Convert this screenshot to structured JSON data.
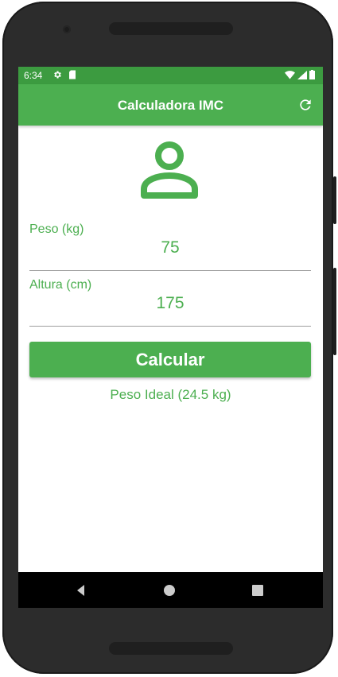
{
  "status_bar": {
    "time": "6:34",
    "left_icons": [
      "gear-icon",
      "sd-card-icon"
    ],
    "right_icons": [
      "wifi-icon",
      "signal-icon",
      "battery-icon"
    ]
  },
  "app_bar": {
    "title": "Calculadora IMC",
    "action_icon": "refresh-icon"
  },
  "main": {
    "avatar_icon": "person-icon",
    "weight_field": {
      "label": "Peso (kg)",
      "value": "75"
    },
    "height_field": {
      "label": "Altura (cm)",
      "value": "175"
    },
    "calculate_button": "Calcular",
    "result": "Peso Ideal (24.5 kg)"
  },
  "nav_bar": {
    "buttons": [
      "back-icon",
      "home-icon",
      "recents-icon"
    ]
  },
  "colors": {
    "primary": "#4caf50",
    "primary_dark": "#3c9b40",
    "device_body": "#2c2c2c"
  }
}
